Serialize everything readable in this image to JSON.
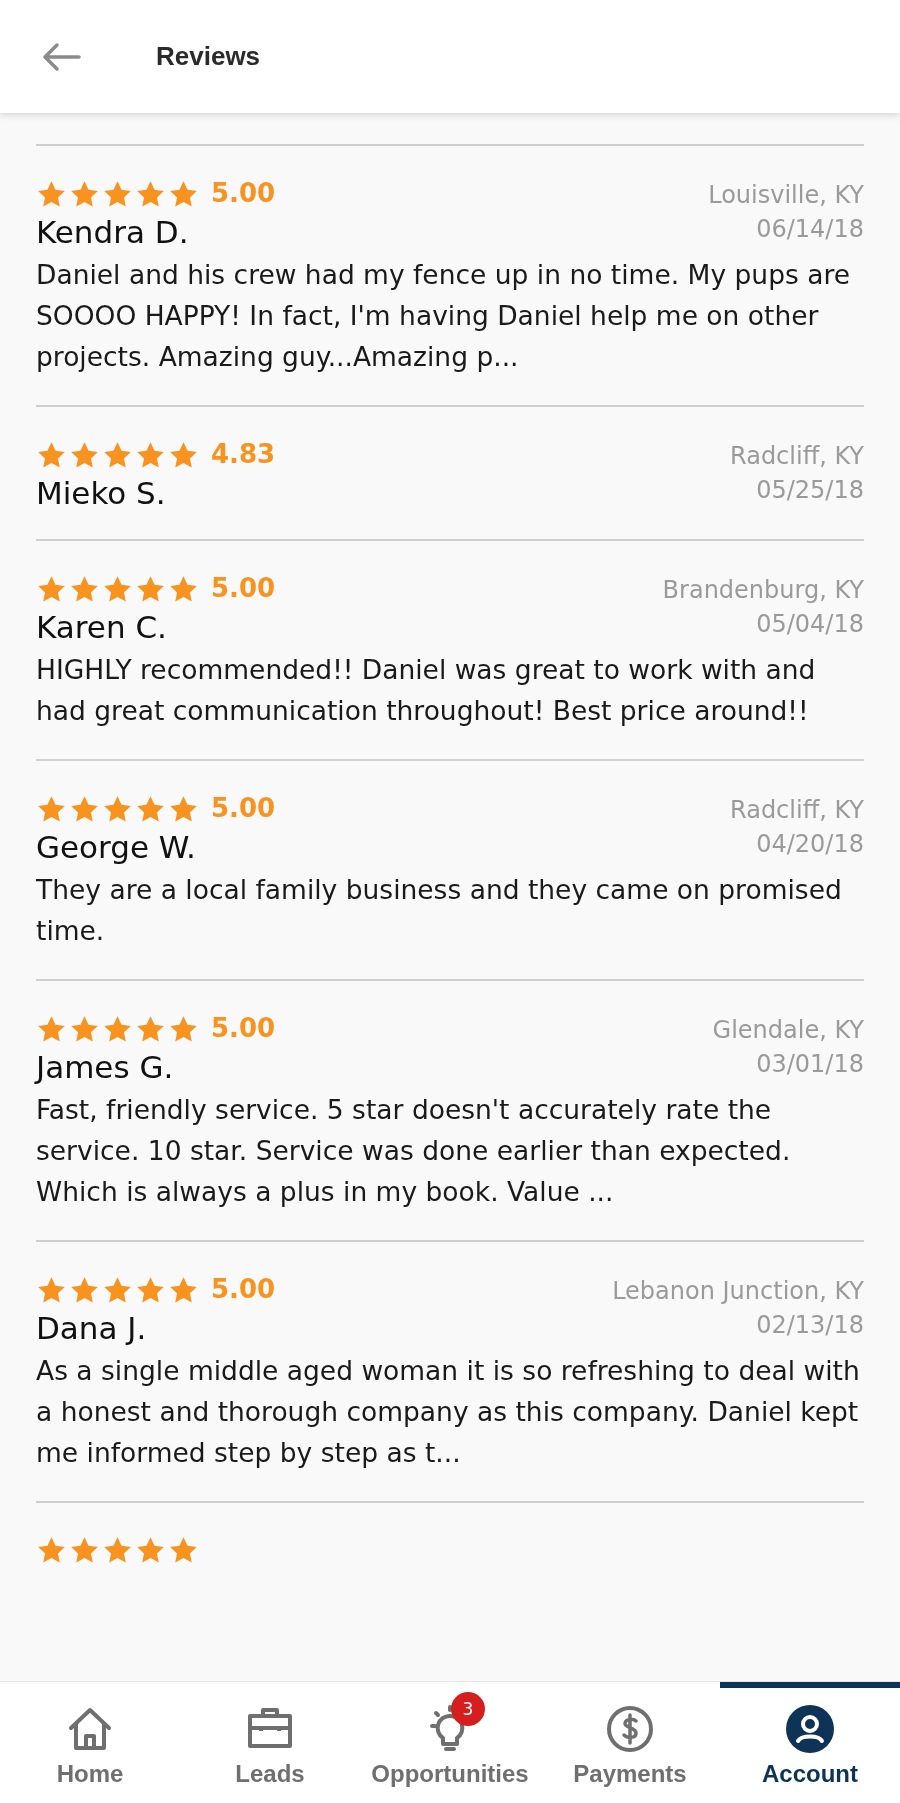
{
  "header": {
    "title": "Reviews"
  },
  "reviews": [
    {
      "stars": 5,
      "rating": "5.00",
      "name": "Kendra D.",
      "location": "Louisville, KY",
      "date": "06/14/18",
      "text": "Daniel and his crew had my fence up in no time. My pups are SOOOO HAPPY! In fact, I'm having Daniel help me on other projects. Amazing guy...Amazing p..."
    },
    {
      "stars": 5,
      "rating": "4.83",
      "name": "Mieko S.",
      "location": "Radcliff, KY",
      "date": "05/25/18"
    },
    {
      "stars": 5,
      "rating": "5.00",
      "name": "Karen C.",
      "location": "Brandenburg, KY",
      "date": "05/04/18",
      "text": "HIGHLY recommended!! Daniel was great to work with and had great communication throughout! Best price around!!"
    },
    {
      "stars": 5,
      "rating": "5.00",
      "name": "George W.",
      "location": "Radcliff, KY",
      "date": "04/20/18",
      "text": "They are a local family business and they came on promised time."
    },
    {
      "stars": 5,
      "rating": "5.00",
      "name": "James G.",
      "location": "Glendale, KY",
      "date": "03/01/18",
      "text": "Fast, friendly service. 5 star doesn't accurately rate the service. 10 star. Service was done earlier than expected. Which is always a plus in my book. Value ..."
    },
    {
      "stars": 5,
      "rating": "5.00",
      "name": "Dana J.",
      "location": "Lebanon Junction, KY",
      "date": "02/13/18",
      "text": "As a single middle aged woman it is so refreshing to deal with a honest and thorough company as this company. Daniel kept me informed step by step as t..."
    },
    {
      "stars": 5
    }
  ],
  "nav": [
    {
      "kind": "home",
      "label": "Home",
      "selected": false
    },
    {
      "kind": "leads",
      "label": "Leads",
      "selected": false
    },
    {
      "kind": "opportunities",
      "label": "Opportunities",
      "selected": false,
      "badge": "3"
    },
    {
      "kind": "payments",
      "label": "Payments",
      "selected": false
    },
    {
      "kind": "account",
      "label": "Account",
      "selected": true
    }
  ]
}
